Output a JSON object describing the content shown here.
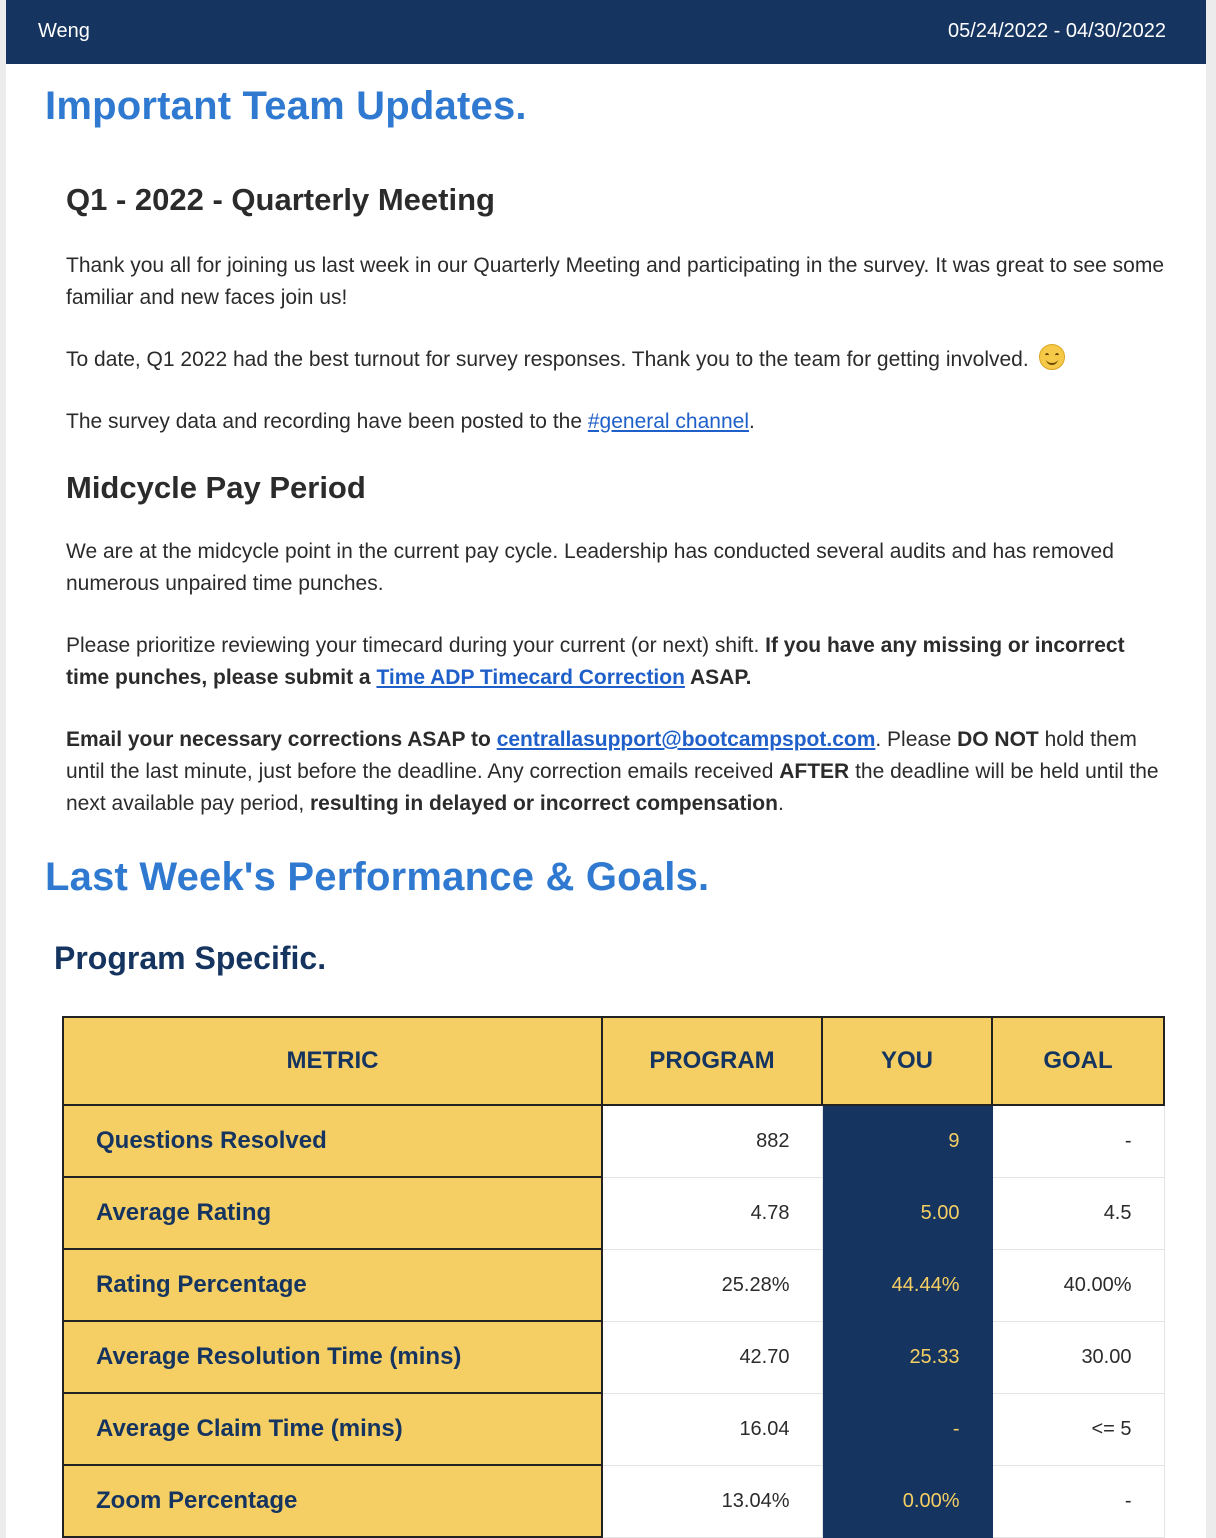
{
  "header": {
    "name": "Weng",
    "date_range": "05/24/2022 - 04/30/2022"
  },
  "updates": {
    "heading": "Important Team Updates.",
    "quarterly": {
      "heading": "Q1 - 2022 - Quarterly Meeting",
      "p1": "Thank you all for joining us last week in our Quarterly Meeting and participating in the survey. It was great to see some familiar and new faces join us!",
      "p2": "To date, Q1 2022 had the best turnout for survey responses. Thank you to the team for getting involved.",
      "p2_emoji": "smiling-face-emoji",
      "p3_prefix": "The survey data and recording have been posted to the ",
      "p3_link": "#general channel",
      "p3_suffix": "."
    },
    "midcycle": {
      "heading": "Midcycle Pay Period",
      "p1": "We are at the midcycle point in the current pay cycle. Leadership has conducted several audits and has removed numerous unpaired time punches.",
      "p2_prefix": "Please prioritize reviewing your timecard during your current (or next) shift. ",
      "p2_bold": "If you have any missing or incorrect time punches, please submit a ",
      "p2_link": "Time ADP Timecard Correction",
      "p2_bold_suffix": " ASAP.",
      "p3_bold": "Email your necessary corrections ASAP to ",
      "p3_email": "centrallasupport@bootcampspot.com",
      "p3_t1": ". Please ",
      "p3_b1": "DO NOT",
      "p3_t2": " hold them until the last minute, just before the deadline. Any correction emails received ",
      "p3_b2": "AFTER",
      "p3_t3": " the deadline will be held until the next available pay period, ",
      "p3_b3": "resulting in delayed or incorrect compensation",
      "p3_t4": "."
    }
  },
  "performance": {
    "heading": "Last Week's Performance & Goals.",
    "subheading": "Program Specific.",
    "columns": [
      "METRIC",
      "PROGRAM",
      "YOU",
      "GOAL"
    ],
    "rows": [
      {
        "metric": "Questions Resolved",
        "program": "882",
        "you": "9",
        "goal": "-"
      },
      {
        "metric": "Average Rating",
        "program": "4.78",
        "you": "5.00",
        "goal": "4.5"
      },
      {
        "metric": "Rating Percentage",
        "program": "25.28%",
        "you": "44.44%",
        "goal": "40.00%"
      },
      {
        "metric": "Average Resolution Time (mins)",
        "program": "42.70",
        "you": "25.33",
        "goal": "30.00"
      },
      {
        "metric": "Average Claim Time (mins)",
        "program": "16.04",
        "you": "-",
        "goal": "<= 5"
      },
      {
        "metric": "Zoom Percentage",
        "program": "13.04%",
        "you": "0.00%",
        "goal": "-"
      }
    ]
  },
  "colors": {
    "navy": "#15345f",
    "gold": "#f6cf64",
    "heading_blue": "#2f7ad0",
    "link": "#1f5fc9"
  }
}
